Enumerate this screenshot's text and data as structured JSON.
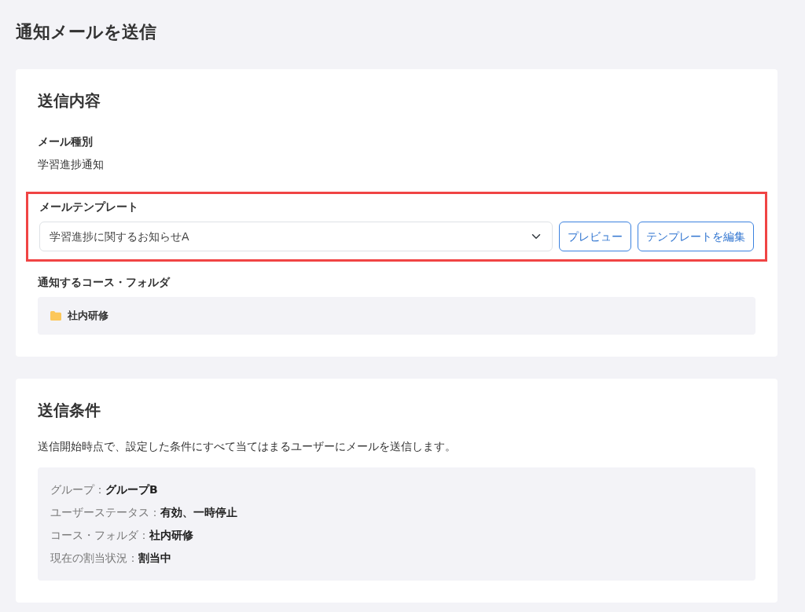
{
  "page_title": "通知メールを送信",
  "content_card": {
    "title": "送信内容",
    "mail_type": {
      "label": "メール種別",
      "value": "学習進捗通知"
    },
    "template": {
      "label": "メールテンプレート",
      "value": "学習進捗に関するお知らせA",
      "highlighted": true,
      "buttons": [
        "プレビュー",
        "テンプレートを編集"
      ]
    },
    "course": {
      "label": "通知するコース・フォルダ",
      "folder": "社内研修"
    }
  },
  "conditions_card": {
    "title": "送信条件",
    "description": "送信開始時点で、設定した条件にすべて当てはまるユーザーにメールを送信します。",
    "conditions": [
      {
        "label": "グループ：",
        "value": "グループB"
      },
      {
        "label": "ユーザーステータス：",
        "value": "有効、一時停止"
      },
      {
        "label": "コース・フォルダ：",
        "value": "社内研修"
      },
      {
        "label": "現在の割当状況：",
        "value": "割当中"
      }
    ]
  }
}
